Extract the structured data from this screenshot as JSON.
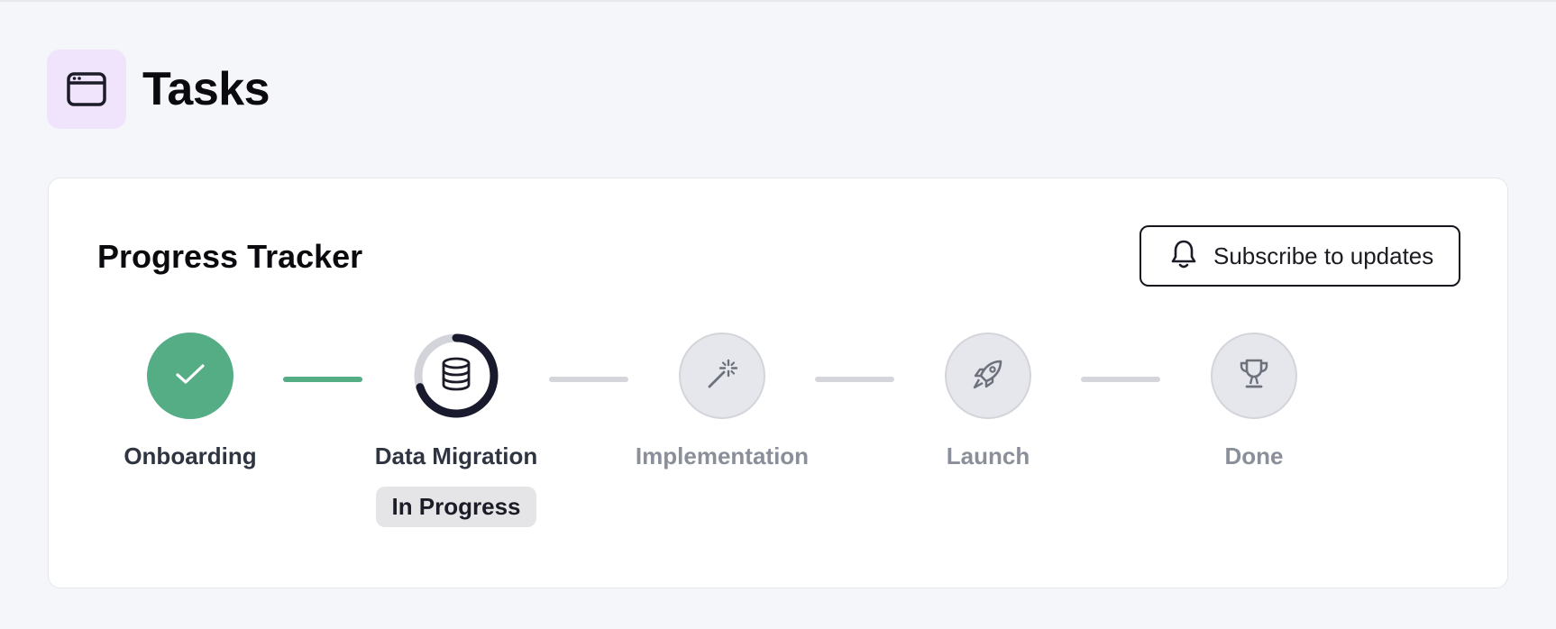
{
  "page": {
    "title": "Tasks",
    "icon": "browser-window-icon"
  },
  "tracker": {
    "title": "Progress Tracker",
    "subscribe_label": "Subscribe to updates",
    "subscribe_icon": "bell-icon",
    "current_progress": 0.7,
    "steps": [
      {
        "label": "Onboarding",
        "state": "done",
        "icon": "check-icon"
      },
      {
        "label": "Data Migration",
        "state": "current",
        "icon": "database-icon",
        "status": "In Progress"
      },
      {
        "label": "Implementation",
        "state": "pending",
        "icon": "magic-wand-icon"
      },
      {
        "label": "Launch",
        "state": "pending",
        "icon": "rocket-icon"
      },
      {
        "label": "Done",
        "state": "pending",
        "icon": "trophy-icon"
      }
    ]
  },
  "colors": {
    "complete": "#55ad86",
    "current_ring": "#1a1a2e",
    "pending": "#d4d6dc",
    "icon_tile": "#efe4fb"
  }
}
